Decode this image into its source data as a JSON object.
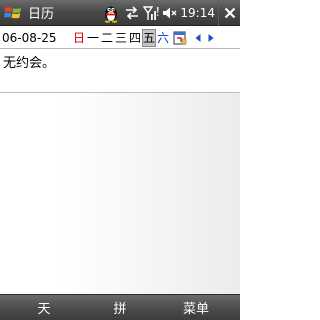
{
  "titlebar": {
    "app_title": "日历",
    "clock": "19:14",
    "icons": [
      "windows-start-icon",
      "qq-penguin-icon",
      "sync-arrows-icon",
      "signal-icon",
      "speaker-icon",
      "close-icon"
    ]
  },
  "datebar": {
    "date": "06-08-25",
    "weekdays": [
      "日",
      "一",
      "二",
      "三",
      "四",
      "五",
      "六"
    ],
    "selected_weekday": "五",
    "colors": {
      "sunday": "#d40000",
      "saturday": "#0033cc",
      "selected_bg": "#c6c6c6"
    }
  },
  "content": {
    "no_appointments": "无约会。"
  },
  "softkeys": {
    "left": "天",
    "ime": "拼",
    "right": "菜单"
  }
}
